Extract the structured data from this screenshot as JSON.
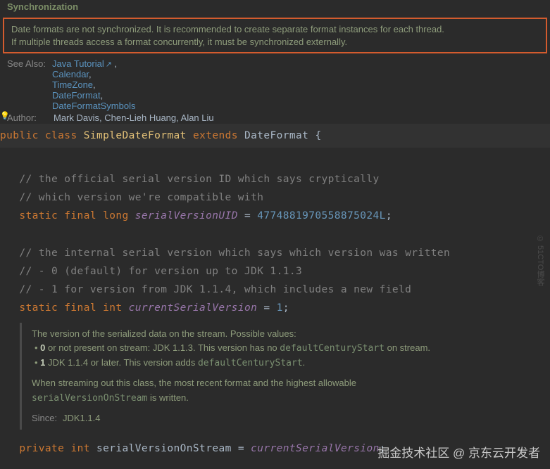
{
  "header": {
    "section": "Synchronization",
    "syncWarning1": "Date formats are not synchronized. It is recommended to create separate format instances for each thread.",
    "syncWarning2": "If multiple threads access a format concurrently, it must be synchronized externally."
  },
  "seeAlso": {
    "label": "See Also:",
    "links": [
      "Java Tutorial",
      "Calendar",
      "TimeZone",
      "DateFormat",
      "DateFormatSymbols"
    ]
  },
  "author": {
    "label": "Author:",
    "text": "Mark Davis, Chen-Lieh Huang, Alan Liu"
  },
  "signature": {
    "kw_public": "public",
    "kw_class": "class",
    "name": "SimpleDateFormat",
    "kw_extends": "extends",
    "super": "DateFormat",
    "brace": "{"
  },
  "code": {
    "c1": "// the official serial version ID which says cryptically",
    "c2": "// which version we're compatible with",
    "l3_kw": "static final long",
    "l3_id": "serialVersionUID",
    "l3_eq": " = ",
    "l3_num": "4774881970558875024L",
    "c4": "// the internal serial version which says which version was written",
    "c5": "// - 0 (default) for version up to JDK 1.1.3",
    "c6": "// - 1 for version from JDK 1.1.4, which includes a new field",
    "l7_kw": "static final int",
    "l7_id": "currentSerialVersion",
    "l7_num": "1",
    "l8_kw1": "private",
    "l8_kw2": "int",
    "l8_id": "serialVersionOnStream",
    "l8_rhs": "currentSerialVersion"
  },
  "doc": {
    "d1": "The version of the serialized data on the stream. Possible values:",
    "li0_b": "0",
    "li0_t": " or not present on stream: JDK 1.1.3. This version has no ",
    "li0_c": "defaultCenturyStart",
    "li0_t2": " on stream.",
    "li1_b": "1",
    "li1_t": " JDK 1.1.4 or later. This version adds ",
    "li1_c": "defaultCenturyStart",
    "d2a": "When streaming out this class, the most recent format and the highest allowable ",
    "d2c": "serialVersionOnStream",
    "d2b": " is written.",
    "sinceLabel": "Since:",
    "sinceVal": "JDK1.1.4"
  },
  "watermark": "掘金技术社区 @ 京东云开发者",
  "watermark2": "© 51CTO博客"
}
